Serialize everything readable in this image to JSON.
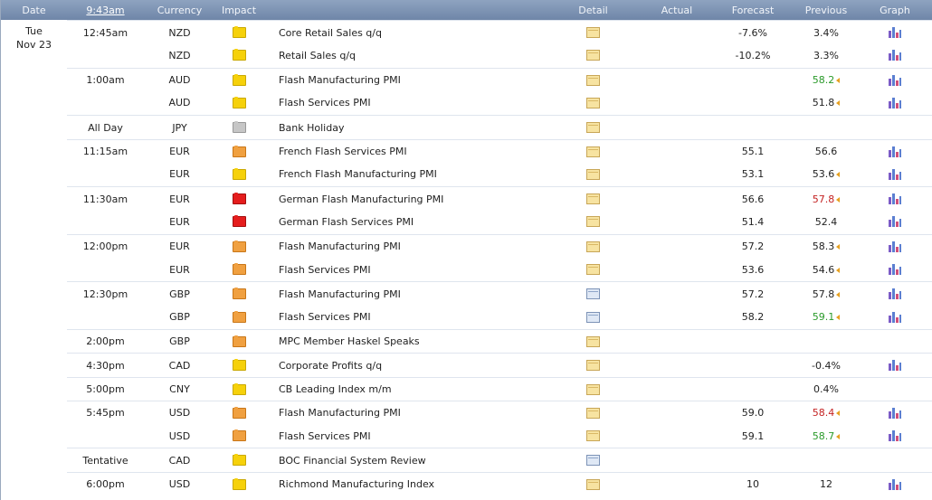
{
  "header": {
    "date": "Date",
    "time": "9:43am",
    "currency": "Currency",
    "impact": "Impact",
    "detail": "Detail",
    "actual": "Actual",
    "forecast": "Forecast",
    "previous": "Previous",
    "graph": "Graph"
  },
  "day": {
    "weekday": "Tue",
    "date": "Nov 23"
  },
  "impact_colors": {
    "yellow": "#f6d10a",
    "orange": "#f0a040",
    "red": "#e51d1d",
    "gray": "#c6c6c6"
  },
  "prev_colors": {
    "better": "#2a9a2a",
    "worse": "#c42222"
  },
  "rows": [
    {
      "time": "12:45am",
      "currency": "NZD",
      "impact": "yellow",
      "event": "Core Retail Sales q/q",
      "forecast": "-7.6%",
      "previous": "3.4%",
      "prev_state": "",
      "graph": true,
      "detail_icon": "folder-icon"
    },
    {
      "time": "",
      "currency": "NZD",
      "impact": "yellow",
      "event": "Retail Sales q/q",
      "forecast": "-10.2%",
      "previous": "3.3%",
      "prev_state": "",
      "graph": true,
      "detail_icon": "folder-icon"
    },
    {
      "time": "1:00am",
      "currency": "AUD",
      "impact": "yellow",
      "event": "Flash Manufacturing PMI",
      "forecast": "",
      "previous": "58.2",
      "prev_state": "better",
      "graph": true,
      "detail_icon": "folder-icon"
    },
    {
      "time": "",
      "currency": "AUD",
      "impact": "yellow",
      "event": "Flash Services PMI",
      "forecast": "",
      "previous": "51.8",
      "prev_state": "neutral-arrow",
      "graph": true,
      "detail_icon": "folder-icon"
    },
    {
      "time": "All Day",
      "currency": "JPY",
      "impact": "gray",
      "event": "Bank Holiday",
      "forecast": "",
      "previous": "",
      "prev_state": "",
      "graph": false,
      "detail_icon": "folder-icon"
    },
    {
      "time": "11:15am",
      "currency": "EUR",
      "impact": "orange",
      "event": "French Flash Services PMI",
      "forecast": "55.1",
      "previous": "56.6",
      "prev_state": "",
      "graph": true,
      "detail_icon": "folder-icon"
    },
    {
      "time": "",
      "currency": "EUR",
      "impact": "yellow",
      "event": "French Flash Manufacturing PMI",
      "forecast": "53.1",
      "previous": "53.6",
      "prev_state": "neutral-arrow",
      "graph": true,
      "detail_icon": "folder-icon"
    },
    {
      "time": "11:30am",
      "currency": "EUR",
      "impact": "red",
      "event": "German Flash Manufacturing PMI",
      "forecast": "56.6",
      "previous": "57.8",
      "prev_state": "worse",
      "graph": true,
      "detail_icon": "folder-icon"
    },
    {
      "time": "",
      "currency": "EUR",
      "impact": "red",
      "event": "German Flash Services PMI",
      "forecast": "51.4",
      "previous": "52.4",
      "prev_state": "",
      "graph": true,
      "detail_icon": "folder-icon"
    },
    {
      "time": "12:00pm",
      "currency": "EUR",
      "impact": "orange",
      "event": "Flash Manufacturing PMI",
      "forecast": "57.2",
      "previous": "58.3",
      "prev_state": "neutral-arrow",
      "graph": true,
      "detail_icon": "folder-icon"
    },
    {
      "time": "",
      "currency": "EUR",
      "impact": "orange",
      "event": "Flash Services PMI",
      "forecast": "53.6",
      "previous": "54.6",
      "prev_state": "neutral-arrow",
      "graph": true,
      "detail_icon": "folder-icon"
    },
    {
      "time": "12:30pm",
      "currency": "GBP",
      "impact": "orange",
      "event": "Flash Manufacturing PMI",
      "forecast": "57.2",
      "previous": "57.8",
      "prev_state": "neutral-arrow",
      "graph": true,
      "detail_icon": "document-icon"
    },
    {
      "time": "",
      "currency": "GBP",
      "impact": "orange",
      "event": "Flash Services PMI",
      "forecast": "58.2",
      "previous": "59.1",
      "prev_state": "better",
      "graph": true,
      "detail_icon": "document-icon"
    },
    {
      "time": "2:00pm",
      "currency": "GBP",
      "impact": "orange",
      "event": "MPC Member Haskel Speaks",
      "forecast": "",
      "previous": "",
      "prev_state": "",
      "graph": false,
      "detail_icon": "folder-icon"
    },
    {
      "time": "4:30pm",
      "currency": "CAD",
      "impact": "yellow",
      "event": "Corporate Profits q/q",
      "forecast": "",
      "previous": "-0.4%",
      "prev_state": "",
      "graph": true,
      "detail_icon": "folder-icon"
    },
    {
      "time": "5:00pm",
      "currency": "CNY",
      "impact": "yellow",
      "event": "CB Leading Index m/m",
      "forecast": "",
      "previous": "0.4%",
      "prev_state": "",
      "graph": false,
      "detail_icon": "folder-icon"
    },
    {
      "time": "5:45pm",
      "currency": "USD",
      "impact": "orange",
      "event": "Flash Manufacturing PMI",
      "forecast": "59.0",
      "previous": "58.4",
      "prev_state": "worse",
      "graph": true,
      "detail_icon": "folder-icon"
    },
    {
      "time": "",
      "currency": "USD",
      "impact": "orange",
      "event": "Flash Services PMI",
      "forecast": "59.1",
      "previous": "58.7",
      "prev_state": "better",
      "graph": true,
      "detail_icon": "folder-icon"
    },
    {
      "time": "Tentative",
      "currency": "CAD",
      "impact": "yellow",
      "event": "BOC Financial System Review",
      "forecast": "",
      "previous": "",
      "prev_state": "",
      "graph": false,
      "detail_icon": "document-icon"
    },
    {
      "time": "6:00pm",
      "currency": "USD",
      "impact": "yellow",
      "event": "Richmond Manufacturing Index",
      "forecast": "10",
      "previous": "12",
      "prev_state": "",
      "graph": true,
      "detail_icon": "folder-icon"
    }
  ]
}
